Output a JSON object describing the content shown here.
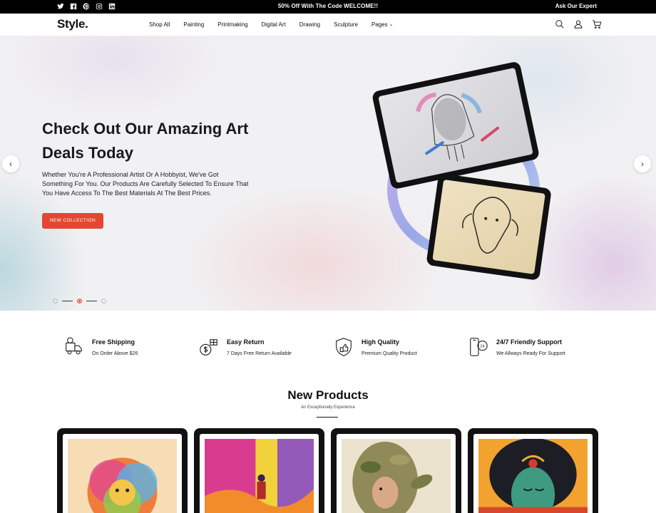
{
  "topbar": {
    "promo": "50% Off With The Code WELCOME!!",
    "expert": "Ask Our Expert",
    "social_icons": [
      "twitter-icon",
      "facebook-icon",
      "pinterest-icon",
      "instagram-icon",
      "linkedin-icon"
    ]
  },
  "header": {
    "logo": "Style.",
    "nav": [
      {
        "label": "Shop All"
      },
      {
        "label": "Painting"
      },
      {
        "label": "Printmaking"
      },
      {
        "label": "Digital Art"
      },
      {
        "label": "Drawing"
      },
      {
        "label": "Sculpture"
      },
      {
        "label": "Pages",
        "has_dropdown": true
      }
    ],
    "icons": [
      "search-icon",
      "user-icon",
      "cart-icon"
    ],
    "cart_count": "0"
  },
  "hero": {
    "title": "Check Out Our Amazing Art Deals Today",
    "text": "Whether You're A Professional Artist Or A Hobbyist, We've Got Something For You. Our Products Are Carefully Selected To Ensure That You Have Access To The Best Materials At The Best Prices.",
    "button": "NEW COLLECTION",
    "slides_total": 3,
    "active_slide": 2
  },
  "features": [
    {
      "icon": "delivery-truck-icon",
      "title": "Free Shipping",
      "subtitle": "On Order Above $26"
    },
    {
      "icon": "money-return-icon",
      "title": "Easy Return",
      "subtitle": "7 Days Free Return Available"
    },
    {
      "icon": "quality-shield-icon",
      "title": "High Quality",
      "subtitle": "Premium Quality Product"
    },
    {
      "icon": "phone-support-icon",
      "title": "24/7 Friendly Support",
      "subtitle": "We Allways Ready For Support"
    }
  ],
  "new_products": {
    "title": "New Products",
    "subtitle": "An Exceptionally Experience"
  },
  "colors": {
    "accent": "#e3472f",
    "topbar_bg": "#000000"
  }
}
